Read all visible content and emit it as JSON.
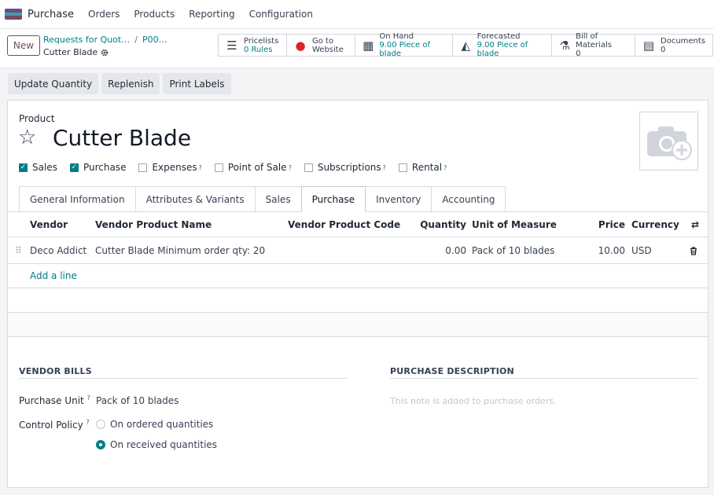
{
  "colors": {
    "accent": "#017e84",
    "brand": "#714b67"
  },
  "navbar": {
    "app_name": "Purchase",
    "menu": [
      "Orders",
      "Products",
      "Reporting",
      "Configuration"
    ]
  },
  "control": {
    "new_label": "New",
    "breadcrumb": [
      "Requests for Quot…",
      "P00…"
    ],
    "current": "Cutter Blade",
    "stats": [
      {
        "icon": "list-icon",
        "line1": "Pricelists",
        "line2": "0 Rules"
      },
      {
        "icon": "globe-icon",
        "line1": "Go to",
        "line2": "Website"
      },
      {
        "icon": "cubes-icon",
        "line1": "On Hand",
        "line2": "9.00 Piece of blade"
      },
      {
        "icon": "area-chart-icon",
        "line1": "Forecasted",
        "line2": "9.00 Piece of blade"
      },
      {
        "icon": "flask-icon",
        "line1": "Bill of Materials",
        "line2": "0"
      },
      {
        "icon": "document-icon",
        "line1": "Documents",
        "line2": "0"
      }
    ]
  },
  "actions": [
    "Update Quantity",
    "Replenish",
    "Print Labels"
  ],
  "product": {
    "label": "Product",
    "name": "Cutter Blade",
    "checkboxes": [
      {
        "label": "Sales",
        "checked": true,
        "help": false
      },
      {
        "label": "Purchase",
        "checked": true,
        "help": false
      },
      {
        "label": "Expenses",
        "checked": false,
        "help": true
      },
      {
        "label": "Point of Sale",
        "checked": false,
        "help": true
      },
      {
        "label": "Subscriptions",
        "checked": false,
        "help": true
      },
      {
        "label": "Rental",
        "checked": false,
        "help": true
      }
    ]
  },
  "tabs": [
    "General Information",
    "Attributes & Variants",
    "Sales",
    "Purchase",
    "Inventory",
    "Accounting"
  ],
  "active_tab": "Purchase",
  "vendor_table": {
    "headers": [
      "Vendor",
      "Vendor Product Name",
      "Vendor Product Code",
      "Quantity",
      "Unit of Measure",
      "Price",
      "Currency"
    ],
    "rows": [
      [
        "Deco Addict",
        "Cutter Blade Minimum order qty: 20",
        "",
        "0.00",
        "Pack of 10 blades",
        "10.00",
        "USD"
      ]
    ],
    "add_line": "Add a line"
  },
  "vendor_bills": {
    "title": "VENDOR BILLS",
    "purchase_unit_label": "Purchase Unit",
    "purchase_unit_value": "Pack of 10 blades",
    "control_policy_label": "Control Policy",
    "options": [
      "On ordered quantities",
      "On received quantities"
    ],
    "selected": "On received quantities"
  },
  "purchase_description": {
    "title": "PURCHASE DESCRIPTION",
    "placeholder": "This note is added to purchase orders."
  }
}
